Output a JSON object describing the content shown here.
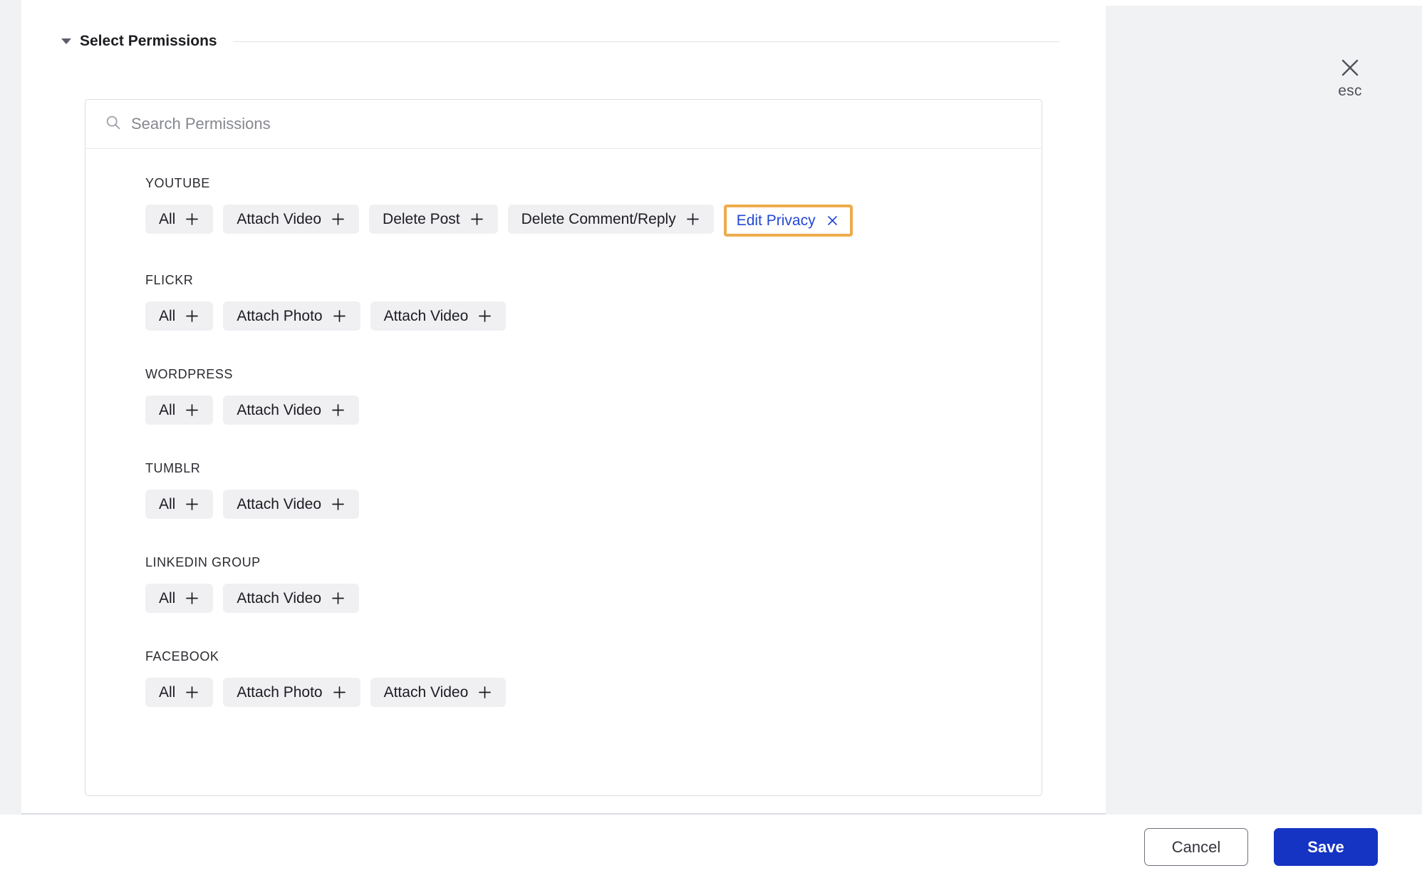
{
  "section": {
    "title": "Select Permissions",
    "caret_icon": "caret-down-icon",
    "expanded": true
  },
  "esc": {
    "icon": "close-x-icon",
    "label": "esc"
  },
  "search": {
    "icon": "search-icon",
    "value": "",
    "placeholder": "Search Permissions"
  },
  "add_icon": "plus-icon",
  "remove_icon": "close-x-icon",
  "colors": {
    "highlight_border": "#eeab4c",
    "selected_text": "#2348d4",
    "chip_background": "#f0f0f3",
    "save_background": "#1534c3",
    "panel_background": "#f1f2f4"
  },
  "groups": [
    {
      "name": "YOUTUBE",
      "chips": [
        {
          "label": "All",
          "state": "add"
        },
        {
          "label": "Attach Video",
          "state": "add"
        },
        {
          "label": "Delete Post",
          "state": "add"
        },
        {
          "label": "Delete Comment/Reply",
          "state": "add"
        },
        {
          "label": "Edit Privacy",
          "state": "selected"
        }
      ]
    },
    {
      "name": "FLICKR",
      "chips": [
        {
          "label": "All",
          "state": "add"
        },
        {
          "label": "Attach Photo",
          "state": "add"
        },
        {
          "label": "Attach Video",
          "state": "add"
        }
      ]
    },
    {
      "name": "WORDPRESS",
      "chips": [
        {
          "label": "All",
          "state": "add"
        },
        {
          "label": "Attach Video",
          "state": "add"
        }
      ]
    },
    {
      "name": "TUMBLR",
      "chips": [
        {
          "label": "All",
          "state": "add"
        },
        {
          "label": "Attach Video",
          "state": "add"
        }
      ]
    },
    {
      "name": "LINKEDIN GROUP",
      "chips": [
        {
          "label": "All",
          "state": "add"
        },
        {
          "label": "Attach Video",
          "state": "add"
        }
      ]
    },
    {
      "name": "FACEBOOK",
      "chips": [
        {
          "label": "All",
          "state": "add"
        },
        {
          "label": "Attach Photo",
          "state": "add"
        },
        {
          "label": "Attach Video",
          "state": "add"
        }
      ]
    }
  ],
  "footer": {
    "cancel_label": "Cancel",
    "save_label": "Save"
  }
}
